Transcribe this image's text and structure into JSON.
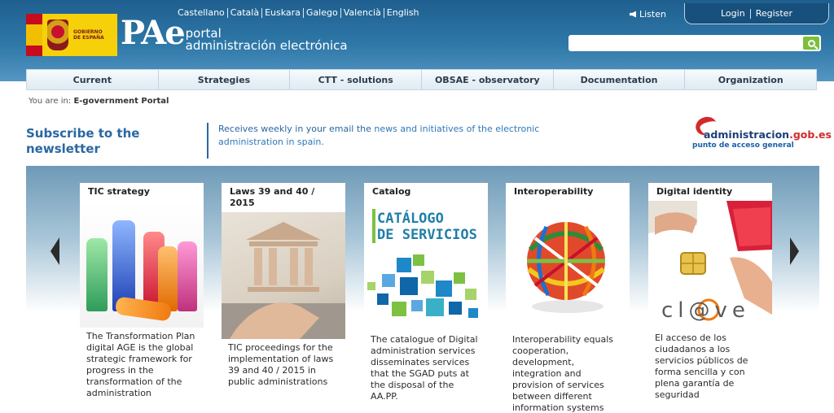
{
  "header": {
    "languages": [
      "Castellano",
      "Català",
      "Euskara",
      "Galego",
      "Valencià",
      "English"
    ],
    "listen_label": "Listen",
    "login_label": "Login",
    "register_label": "Register",
    "search_placeholder": "",
    "logo_gobierno_line1": "GOBIERNO",
    "logo_gobierno_line2": "DE ESPAÑA",
    "logo_pae": "PAe",
    "logo_portal": "portal",
    "logo_subtitle": "administración electrónica"
  },
  "nav": {
    "items": [
      "Current",
      "Strategies",
      "CTT - solutions",
      "OBSAE - observatory",
      "Documentation",
      "Organization"
    ]
  },
  "breadcrumb": {
    "prefix": "You are in:",
    "current": "E-government Portal"
  },
  "newsletter": {
    "title": "Subscribe to the newsletter",
    "text_before": "Receives weekly in your email the ",
    "text_link": "news and initiatives of the electronic administration in spain",
    "text_after": "."
  },
  "partner_logo": {
    "name_prefix": "administracion",
    "name_domain": ".gob.es",
    "tagline": "punto de acceso general"
  },
  "cards": [
    {
      "title": "TIC strategy",
      "text": "The Transformation Plan digital AGE is the global strategic framework for progress in the transformation of the administration"
    },
    {
      "title": "Laws 39 and 40 / 2015",
      "text": "TIC proceedings for the implementation of laws 39 and 40 / 2015 in public administrations"
    },
    {
      "title": "Catalog",
      "text": "The catalogue of Digital administration services disseminates services that the SGAD puts at the disposal of the AA.PP.",
      "image_text_1": "CATÁLOGO",
      "image_text_2": "DE SERVICIOS"
    },
    {
      "title": "Interoperability",
      "text": "Interoperability equals cooperation, development, integration and provision of services between different information systems"
    },
    {
      "title": "Digital identity",
      "text": "El acceso de los ciudadanos a los servicios públicos de forma sencilla y con plena garantía de seguridad",
      "image_text": "cl@ve"
    }
  ],
  "colors": {
    "header_blue": "#2e78a8",
    "link_blue": "#2a67a2",
    "search_green": "#7cbf3b"
  }
}
